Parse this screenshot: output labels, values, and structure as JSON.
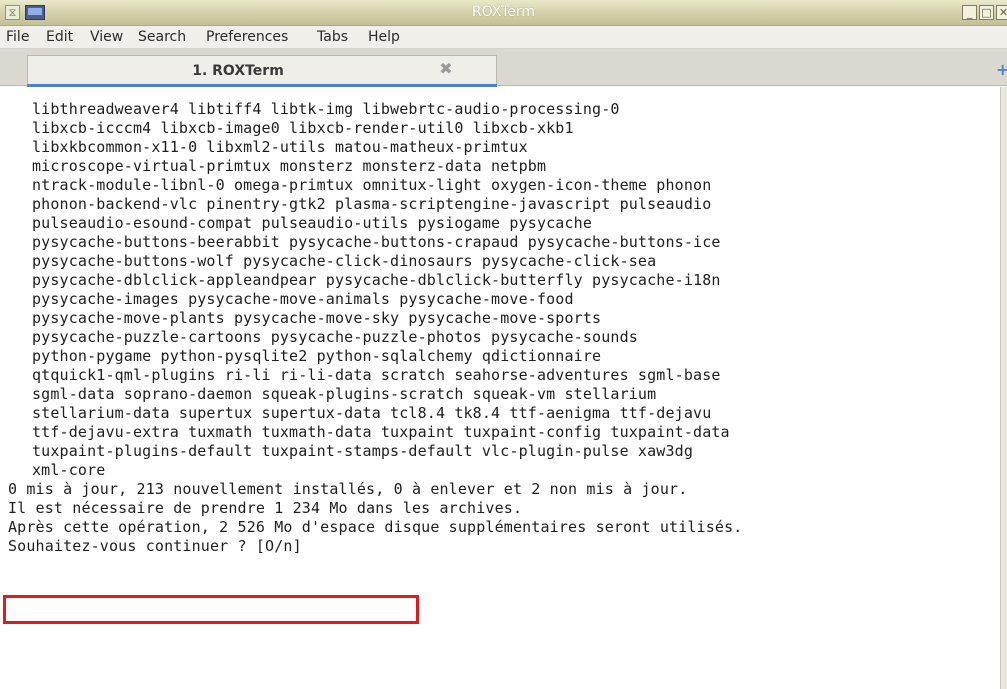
{
  "window": {
    "title": "ROXTerm",
    "min_glyph": "_",
    "max_glyph": "□",
    "close_glyph": "✕"
  },
  "menu": [
    "File",
    "Edit",
    "View",
    "Search",
    "Preferences",
    "Tabs",
    "Help"
  ],
  "tabs": [
    {
      "label": "1. ROXTerm",
      "close_glyph": "✖"
    }
  ],
  "new_tab_glyph": "+",
  "terminal_lines": [
    "libthreadweaver4 libtiff4 libtk-img libwebrtc-audio-processing-0",
    "libxcb-icccm4 libxcb-image0 libxcb-render-util0 libxcb-xkb1",
    "libxkbcommon-x11-0 libxml2-utils matou-matheux-primtux",
    "microscope-virtual-primtux monsterz monsterz-data netpbm",
    "ntrack-module-libnl-0 omega-primtux omnitux-light oxygen-icon-theme phonon",
    "phonon-backend-vlc pinentry-gtk2 plasma-scriptengine-javascript pulseaudio",
    "pulseaudio-esound-compat pulseaudio-utils pysiogame pysycache",
    "pysycache-buttons-beerabbit pysycache-buttons-crapaud pysycache-buttons-ice",
    "pysycache-buttons-wolf pysycache-click-dinosaurs pysycache-click-sea",
    "pysycache-dblclick-appleandpear pysycache-dblclick-butterfly pysycache-i18n",
    "pysycache-images pysycache-move-animals pysycache-move-food",
    "pysycache-move-plants pysycache-move-sky pysycache-move-sports",
    "pysycache-puzzle-cartoons pysycache-puzzle-photos pysycache-sounds",
    "python-pygame python-pysqlite2 python-sqlalchemy qdictionnaire",
    "qtquick1-qml-plugins ri-li ri-li-data scratch seahorse-adventures sgml-base",
    "sgml-data soprano-daemon squeak-plugins-scratch squeak-vm stellarium",
    "stellarium-data supertux supertux-data tcl8.4 tk8.4 ttf-aenigma ttf-dejavu",
    "ttf-dejavu-extra tuxmath tuxmath-data tuxpaint tuxpaint-config tuxpaint-data",
    "tuxpaint-plugins-default tuxpaint-stamps-default vlc-plugin-pulse xaw3dg",
    "xml-core"
  ],
  "summary_lines": [
    "0 mis à jour, 213 nouvellement installés, 0 à enlever et 2 non mis à jour.",
    "Il est nécessaire de prendre 1 234 Mo dans les archives.",
    "Après cette opération, 2 526 Mo d'espace disque supplémentaires seront utilisés."
  ],
  "prompt": "Souhaitez-vous continuer ? [O/n]",
  "colors": {
    "highlight_border": "#e11a1a",
    "tab_accent": "#4f83c9"
  }
}
